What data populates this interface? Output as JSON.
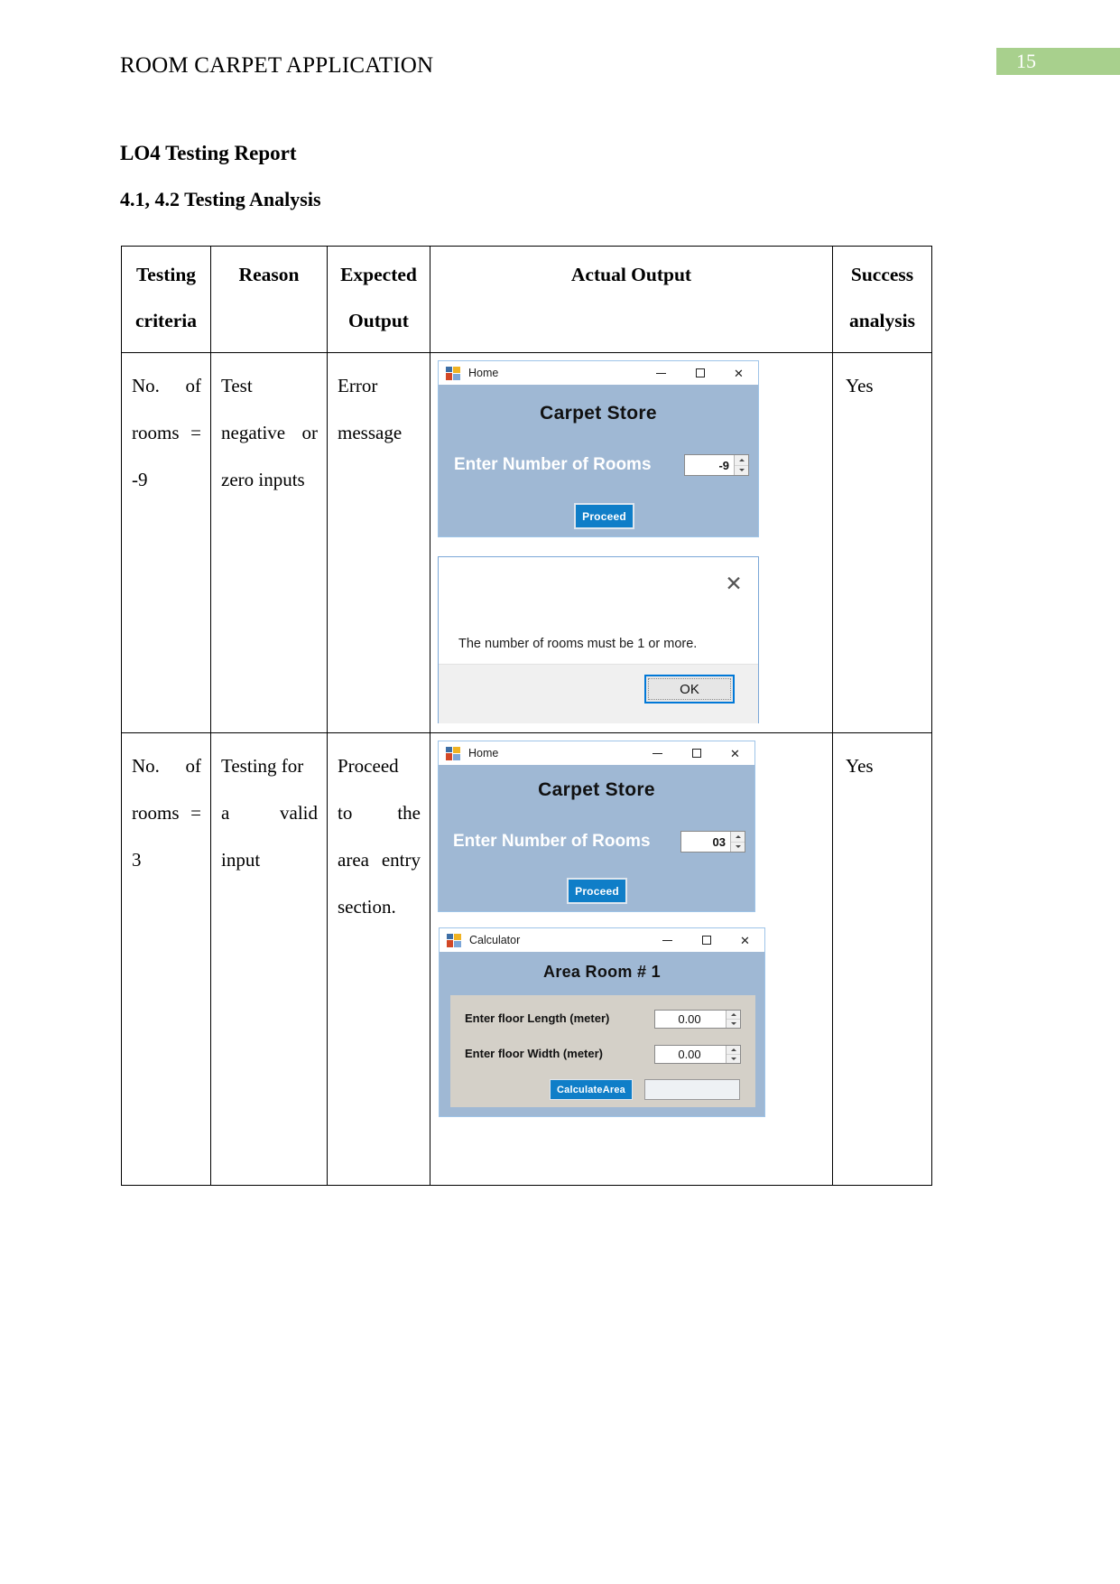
{
  "header": {
    "document_title": "ROOM CARPET APPLICATION",
    "page_number": "15"
  },
  "headings": {
    "h1": "LO4 Testing Report",
    "h2": "4.1, 4.2 Testing Analysis"
  },
  "table": {
    "columns": [
      "Testing criteria",
      "Reason",
      "Expected Output",
      "Actual Output",
      "Success analysis"
    ],
    "column_headers": {
      "c1_line1": "Testing",
      "c1_line2": "criteria",
      "c2_line1": "Reason",
      "c3_line1": "Expected",
      "c3_line2": "Output",
      "c4_line1": "Actual Output",
      "c5_line1": "Success",
      "c5_line2": "analysis"
    },
    "rows": [
      {
        "criteria_lines": [
          "No. of",
          "rooms =",
          "-9"
        ],
        "reason_lines": [
          "Test",
          "negative or",
          "zero inputs"
        ],
        "expected_lines": [
          "Error",
          "message"
        ],
        "success": "Yes"
      },
      {
        "criteria_lines": [
          "No. of",
          "rooms =",
          "3"
        ],
        "reason_lines": [
          "Testing for",
          "a valid",
          "input"
        ],
        "expected_lines": [
          "Proceed",
          "to the",
          "area entry",
          "section."
        ],
        "success": "Yes"
      }
    ]
  },
  "screenshots": {
    "home_form_1": {
      "window_title": "Home",
      "app_icon": "windows-form-icon",
      "minimize_icon": "minimize-icon",
      "maximize_icon": "maximize-icon",
      "close_icon": "close-icon",
      "heading": "Carpet Store",
      "rooms_label": "Enter Number of Rooms",
      "rooms_value": "-9",
      "proceed_label": "Proceed"
    },
    "error_dialog": {
      "close_icon": "close-icon",
      "message": "The number of rooms must be 1 or more.",
      "ok_label": "OK"
    },
    "home_form_2": {
      "window_title": "Home",
      "app_icon": "windows-form-icon",
      "heading": "Carpet Store",
      "rooms_label": "Enter Number of Rooms",
      "rooms_value": "03",
      "proceed_label": "Proceed"
    },
    "calculator_form": {
      "window_title": "Calculator",
      "app_icon": "windows-form-icon",
      "heading": "Area Room # 1",
      "length_label": "Enter floor Length (meter)",
      "length_value": "0.00",
      "width_label": "Enter floor Width (meter)",
      "width_value": "0.00",
      "calculate_label": "CalculateArea",
      "result_value": ""
    }
  },
  "colors": {
    "page_badge_green": "#a8d08d",
    "form_body_blue": "#9fb8d4",
    "button_blue": "#0f7ec8",
    "panel_gray": "#d4d0c8",
    "focus_blue": "#0078d7"
  }
}
